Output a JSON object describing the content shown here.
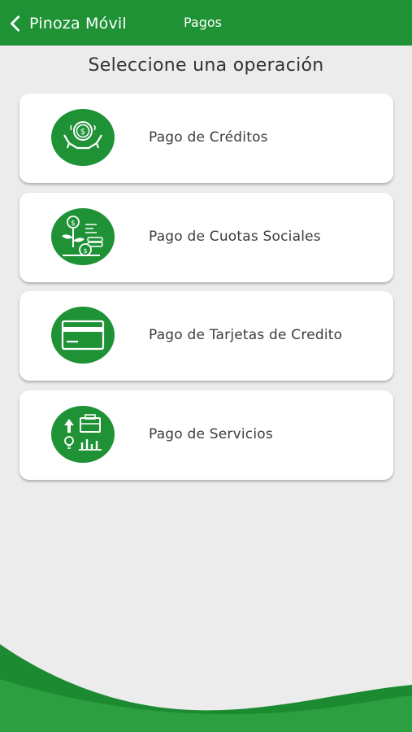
{
  "header": {
    "back_label": "Pinoza Móvil",
    "title": "Pagos",
    "color": "#1f9236"
  },
  "main": {
    "heading": "Seleccione una operación",
    "options": [
      {
        "label": "Pago de Créditos",
        "icon": "money-hands-icon"
      },
      {
        "label": "Pago de Cuotas Sociales",
        "icon": "money-plant-coins-icon"
      },
      {
        "label": "Pago de Tarjetas de Credito",
        "icon": "credit-card-icon"
      },
      {
        "label": "Pago de Servicios",
        "icon": "services-icon"
      }
    ]
  }
}
